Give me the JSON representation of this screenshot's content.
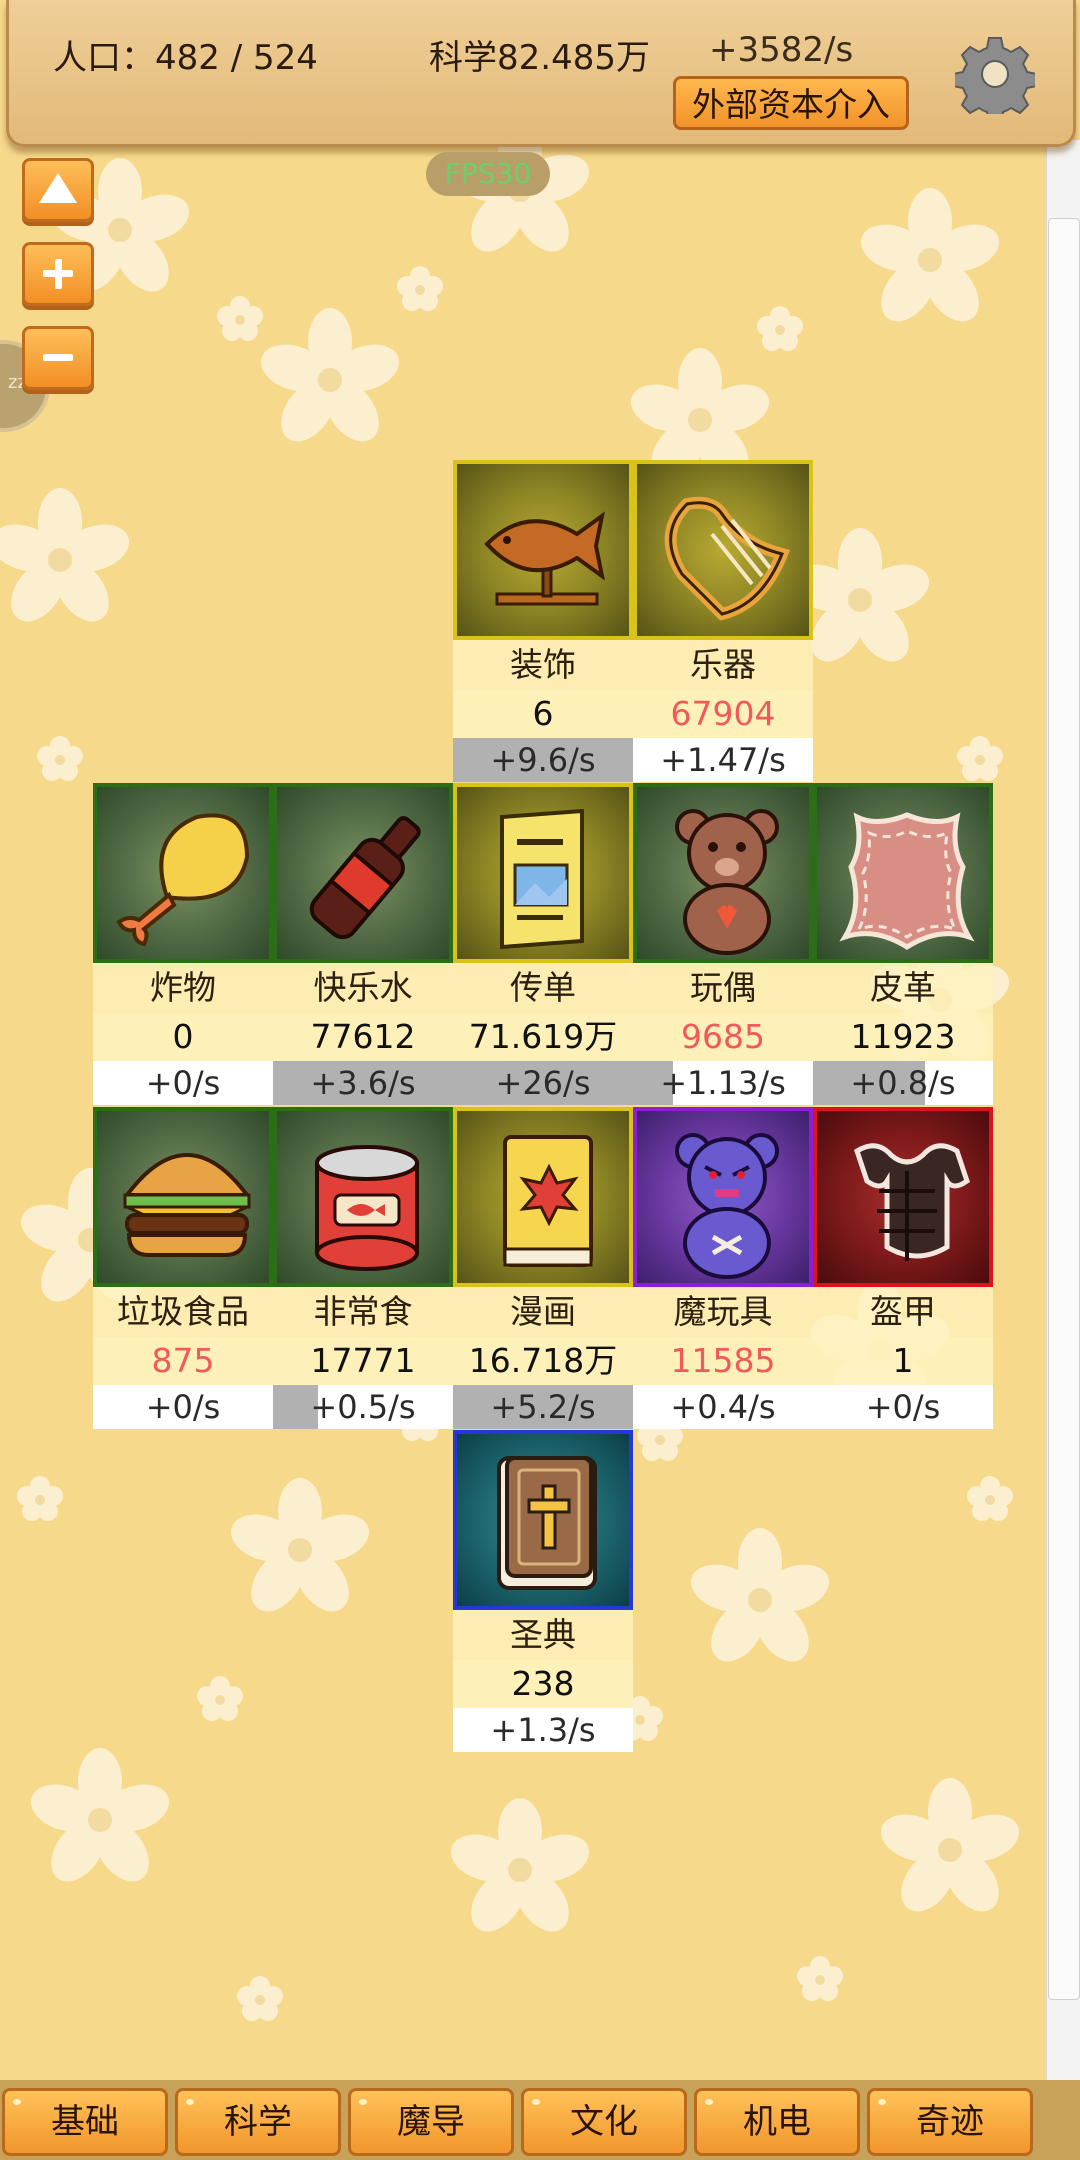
{
  "header": {
    "population_label": "人口：482 / 524",
    "science_label": "科学82.485万",
    "science_rate": "+3582/s",
    "capital_button": "外部资本介入",
    "settings_icon": "gear-icon"
  },
  "fps": "FPS30",
  "side_buttons": [
    "arrow-up-icon",
    "plus-icon",
    "minus-icon"
  ],
  "sleep_badge": "zz",
  "items": [
    {
      "name": "装饰",
      "count": "6",
      "count_color": "normal",
      "rate": "+9.6/s",
      "rate_fill": 1.0,
      "frame": "yellow",
      "icon": "fish-trophy-icon"
    },
    {
      "name": "乐器",
      "count": "67904",
      "count_color": "red",
      "rate": "+1.47/s",
      "rate_fill": 0,
      "frame": "yellow",
      "icon": "lyre-icon"
    },
    {
      "name": "炸物",
      "count": "0",
      "count_color": "normal",
      "rate": "+0/s",
      "rate_fill": 0,
      "frame": "green",
      "icon": "fried-drumstick-icon"
    },
    {
      "name": "快乐水",
      "count": "77612",
      "count_color": "normal",
      "rate": "+3.6/s",
      "rate_fill": 1.0,
      "frame": "green",
      "icon": "soda-bottle-icon"
    },
    {
      "name": "传单",
      "count": "71.619万",
      "count_color": "normal",
      "rate": "+26/s",
      "rate_fill": 1.0,
      "frame": "yellow",
      "icon": "flyer-icon"
    },
    {
      "name": "玩偶",
      "count": "9685",
      "count_color": "red",
      "rate": "+1.13/s",
      "rate_fill": 0.22,
      "frame": "green",
      "icon": "teddy-bear-icon"
    },
    {
      "name": "皮革",
      "count": "11923",
      "count_color": "normal",
      "rate": "+0.8/s",
      "rate_fill": 0.62,
      "frame": "green",
      "icon": "leather-hide-icon"
    },
    {
      "name": "垃圾食品",
      "count": "875",
      "count_color": "red",
      "rate": "+0/s",
      "rate_fill": 0,
      "frame": "green",
      "icon": "burger-icon"
    },
    {
      "name": "非常食",
      "count": "17771",
      "count_color": "normal",
      "rate": "+0.5/s",
      "rate_fill": 0.25,
      "frame": "green",
      "icon": "canned-food-icon"
    },
    {
      "name": "漫画",
      "count": "16.718万",
      "count_color": "normal",
      "rate": "+5.2/s",
      "rate_fill": 1.0,
      "frame": "yellow",
      "icon": "comic-book-icon"
    },
    {
      "name": "魔玩具",
      "count": "11585",
      "count_color": "red",
      "rate": "+0.4/s",
      "rate_fill": 0,
      "frame": "purple",
      "icon": "evil-bear-icon"
    },
    {
      "name": "盔甲",
      "count": "1",
      "count_color": "normal",
      "rate": "+0/s",
      "rate_fill": 0,
      "frame": "red",
      "icon": "armor-icon"
    },
    {
      "name": "圣典",
      "count": "238",
      "count_color": "normal",
      "rate": "+1.3/s",
      "rate_fill": 0,
      "frame": "blue",
      "icon": "holy-book-icon"
    }
  ],
  "tabs": [
    "基础",
    "科学",
    "魔导",
    "文化",
    "机电",
    "奇迹"
  ],
  "colors": {
    "background": "#f6d98a",
    "accent": "#f0932a",
    "red_count": "#f05a5a"
  }
}
